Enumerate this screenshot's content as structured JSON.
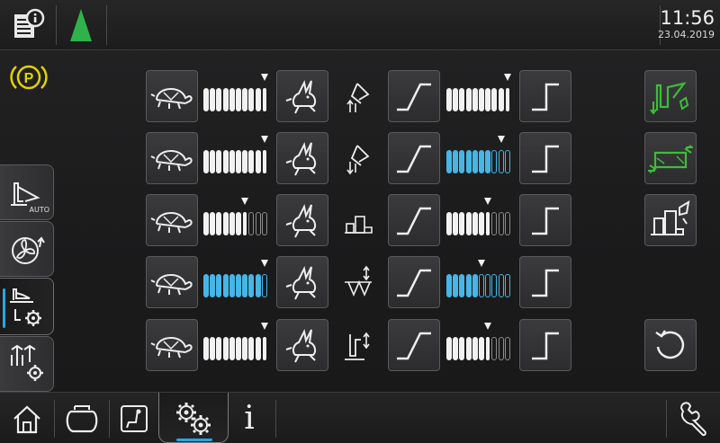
{
  "header": {
    "time": "11:56",
    "date": "23.04.2019",
    "info_icon": "document-info-icon",
    "status_icon": "green-triangle-icon",
    "status_color": "#2fb24a"
  },
  "parking_brake": {
    "icon": "parking-brake-icon",
    "label": "P",
    "color": "#e4d200"
  },
  "side_tabs": [
    {
      "icon": "hitch-auto-icon",
      "label": "AUTO"
    },
    {
      "icon": "fan-icon"
    },
    {
      "icon": "settings-attachment-icon",
      "active": true
    },
    {
      "icon": "tools-settings-icon"
    }
  ],
  "rows": [
    {
      "left_level": 10,
      "left_pointer": 10,
      "left_color": "white",
      "left_filled": 10,
      "right_filled": 10,
      "right_pointer": 10,
      "right_color": "white",
      "row_icon": "lift-up-icon"
    },
    {
      "left_level": 10,
      "left_pointer": 10,
      "left_color": "white",
      "left_filled": 10,
      "right_filled": 7,
      "right_pointer": 9,
      "right_color": "blue",
      "row_icon": "lift-down-icon"
    },
    {
      "left_level": 7,
      "left_pointer": 7,
      "left_color": "white",
      "left_filled": 7,
      "right_filled": 7,
      "right_pointer": 7,
      "right_color": "white",
      "row_icon": "front-hitch-icon"
    },
    {
      "left_level": 9,
      "left_pointer": 10,
      "left_color": "blue",
      "left_filled": 9,
      "right_filled": 5,
      "right_pointer": 6,
      "right_color": "blue",
      "row_icon": "rear-hitch-height-icon"
    },
    {
      "left_level": 10,
      "left_pointer": 10,
      "left_color": "white",
      "left_filled": 10,
      "right_filled": 7,
      "right_pointer": 7,
      "right_color": "white",
      "row_icon": "cylinder-icon"
    }
  ],
  "right_buttons": [
    {
      "icon": "hitch-green-icon",
      "color": "#3dbd3a"
    },
    {
      "icon": "swing-frame-green-icon",
      "color": "#3dbd3a"
    },
    {
      "icon": "machine-config-icon"
    },
    {
      "icon": "reset-icon"
    }
  ],
  "bottom_nav": [
    {
      "icon": "home-icon"
    },
    {
      "icon": "engine-icon"
    },
    {
      "icon": "seat-icon"
    },
    {
      "icon": "gears-settings-icon",
      "active": true
    },
    {
      "icon": "info-icon",
      "label": "i"
    },
    {
      "icon": "wrench-icon"
    }
  ]
}
